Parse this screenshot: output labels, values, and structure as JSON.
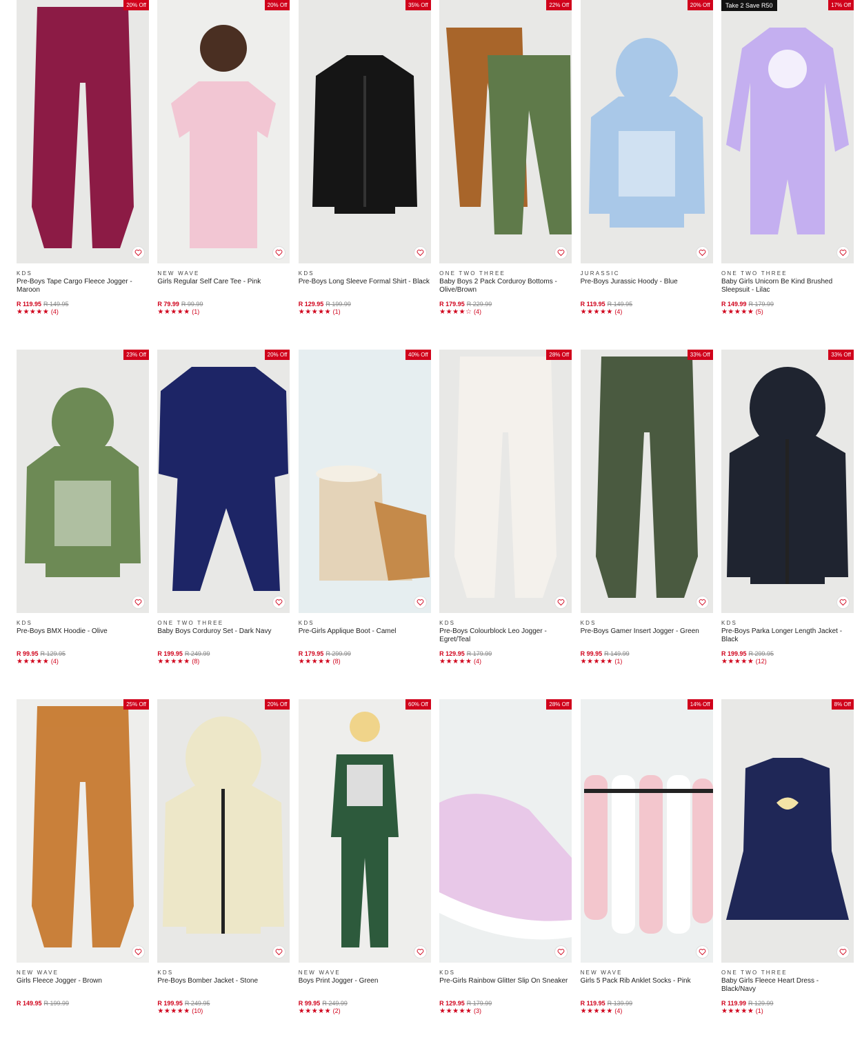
{
  "wishlist_icon": "heart-outline-icon",
  "star_icon": "star-icon",
  "products": [
    {
      "brand": "KDS",
      "name": "Pre-Boys Tape Cargo Fleece Jogger - Maroon",
      "price": "R 119.95",
      "was": "R 149.95",
      "stars": "★★★★★",
      "reviews": "(4)",
      "discount": "20% Off",
      "promo": "",
      "bg": "#e8e8e6",
      "color": "#8c1b45"
    },
    {
      "brand": "NEW WAVE",
      "name": "Girls Regular Self Care Tee - Pink",
      "price": "R 79.99",
      "was": "R 99.99",
      "stars": "★★★★★",
      "reviews": "(1)",
      "discount": "20% Off",
      "promo": "",
      "bg": "#eeeeec",
      "color": "#f2c6d3"
    },
    {
      "brand": "KDS",
      "name": "Pre-Boys Long Sleeve Formal Shirt - Black",
      "price": "R 129.95",
      "was": "R 199.99",
      "stars": "★★★★★",
      "reviews": "(1)",
      "discount": "35% Off",
      "promo": "",
      "bg": "#e8e8e6",
      "color": "#151515"
    },
    {
      "brand": "ONE TWO THREE",
      "name": "Baby Boys 2 Pack Corduroy Bottoms - Olive/Brown",
      "price": "R 179.95",
      "was": "R 229.99",
      "stars": "★★★★☆",
      "reviews": "(4)",
      "discount": "22% Off",
      "promo": "",
      "bg": "#e8e8e6",
      "color": "#5f7a4a"
    },
    {
      "brand": "JURASSIC",
      "name": "Pre-Boys Jurassic Hoody - Blue",
      "price": "R 119.95",
      "was": "R 149.95",
      "stars": "★★★★★",
      "reviews": "(4)",
      "discount": "20% Off",
      "promo": "",
      "bg": "#e8e8e6",
      "color": "#a9c8e8"
    },
    {
      "brand": "ONE TWO THREE",
      "name": "Baby Girls Unicorn Be Kind Brushed Sleepsuit - Lilac",
      "price": "R 149.99",
      "was": "R 179.99",
      "stars": "★★★★★",
      "reviews": "(5)",
      "discount": "17% Off",
      "promo": "Take 2 Save R50",
      "bg": "#e8e8e6",
      "color": "#c4aff0"
    },
    {
      "brand": "KDS",
      "name": "Pre-Boys BMX Hoodie - Olive",
      "price": "R 99.95",
      "was": "R 129.95",
      "stars": "★★★★★",
      "reviews": "(4)",
      "discount": "23% Off",
      "promo": "",
      "bg": "#e8e8e6",
      "color": "#6d8a55"
    },
    {
      "brand": "ONE TWO THREE",
      "name": "Baby Boys Corduroy Set - Dark Navy",
      "price": "R 199.95",
      "was": "R 249.99",
      "stars": "★★★★★",
      "reviews": "(8)",
      "discount": "20% Off",
      "promo": "",
      "bg": "#e8e8e6",
      "color": "#1d2566"
    },
    {
      "brand": "KDS",
      "name": "Pre-Girls Applique Boot - Camel",
      "price": "R 179.95",
      "was": "R 299.99",
      "stars": "★★★★★",
      "reviews": "(8)",
      "discount": "40% Off",
      "promo": "",
      "bg": "#e6eef0",
      "color": "#e4d3b8"
    },
    {
      "brand": "KDS",
      "name": "Pre-Boys Colourblock Leo Jogger - Egret/Teal",
      "price": "R 129.95",
      "was": "R 179.99",
      "stars": "★★★★★",
      "reviews": "(4)",
      "discount": "28% Off",
      "promo": "",
      "bg": "#e8e8e6",
      "color": "#f4f1ec"
    },
    {
      "brand": "KDS",
      "name": "Pre-Boys Gamer Insert Jogger - Green",
      "price": "R 99.95",
      "was": "R 149.99",
      "stars": "★★★★★",
      "reviews": "(1)",
      "discount": "33% Off",
      "promo": "",
      "bg": "#e8e8e6",
      "color": "#4a5a40"
    },
    {
      "brand": "KDS",
      "name": "Pre-Boys Parka Longer Length Jacket - Black",
      "price": "R 199.95",
      "was": "R 299.95",
      "stars": "★★★★★",
      "reviews": "(12)",
      "discount": "33% Off",
      "promo": "",
      "bg": "#e8e8e6",
      "color": "#1f2430"
    },
    {
      "brand": "NEW WAVE",
      "name": "Girls Fleece Jogger - Brown",
      "price": "R 149.95",
      "was": "R 199.99",
      "stars": "",
      "reviews": "",
      "discount": "25% Off",
      "promo": "",
      "bg": "#eeeeec",
      "color": "#c9803a"
    },
    {
      "brand": "KDS",
      "name": "Pre-Boys Bomber Jacket - Stone",
      "price": "R 199.95",
      "was": "R 249.95",
      "stars": "★★★★★",
      "reviews": "(10)",
      "discount": "20% Off",
      "promo": "",
      "bg": "#e8e8e6",
      "color": "#ede7c8"
    },
    {
      "brand": "NEW WAVE",
      "name": "Boys Print Jogger - Green",
      "price": "R 99.95",
      "was": "R 249.99",
      "stars": "★★★★★",
      "reviews": "(2)",
      "discount": "60% Off",
      "promo": "",
      "bg": "#eeeeec",
      "color": "#2d5a3c"
    },
    {
      "brand": "KDS",
      "name": "Pre-Girls Rainbow Glitter Slip On Sneaker",
      "price": "R 129.95",
      "was": "R 179.99",
      "stars": "★★★★★",
      "reviews": "(3)",
      "discount": "28% Off",
      "promo": "",
      "bg": "#edf0f0",
      "color": "#e8c8e8"
    },
    {
      "brand": "NEW WAVE",
      "name": "Girls 5 Pack Rib Anklet Socks - Pink",
      "price": "R 119.95",
      "was": "R 139.99",
      "stars": "★★★★★",
      "reviews": "(4)",
      "discount": "14% Off",
      "promo": "",
      "bg": "#edf0f0",
      "color": "#f1c9cf"
    },
    {
      "brand": "ONE TWO THREE",
      "name": "Baby Girls Fleece Heart Dress - Black/Navy",
      "price": "R 119.99",
      "was": "R 129.99",
      "stars": "★★★★★",
      "reviews": "(1)",
      "discount": "8% Off",
      "promo": "",
      "bg": "#e8e8e6",
      "color": "#1f2757"
    }
  ]
}
